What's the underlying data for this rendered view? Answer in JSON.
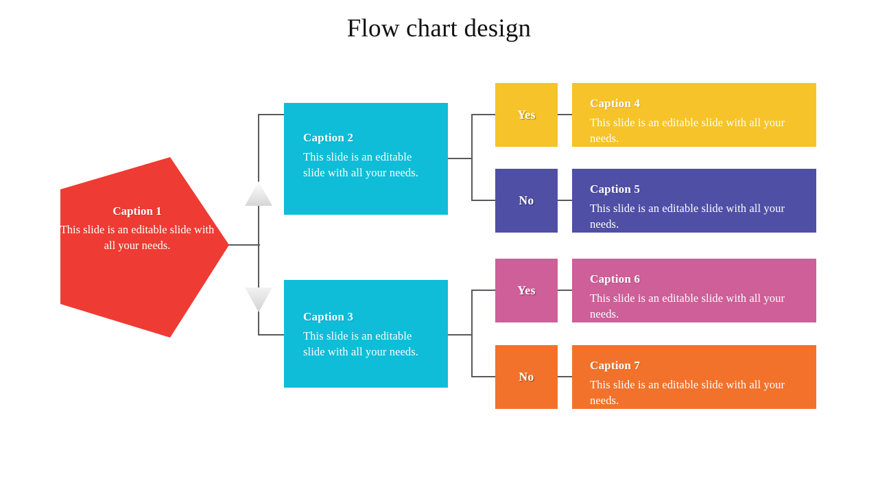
{
  "slide": {
    "title": "Flow chart design",
    "background": "#ffffff"
  },
  "colors": {
    "red": "#ee3b33",
    "cyan": "#0fbdd8",
    "yellow": "#f7c32a",
    "purple": "#4f4fa5",
    "pink": "#ce5f98",
    "orange": "#f2722b",
    "connector": "#595959",
    "triangle_top": "#ffffff",
    "triangle_bottom": "#d9d9d9",
    "text_light": "#ffffff",
    "title_text": "#121212"
  },
  "nodes": {
    "root": {
      "shape": "pentagon",
      "heading": "Caption 1",
      "body": "This slide is an editable slide with all your needs.",
      "color": "#ee3b33"
    },
    "branch_top": {
      "shape": "rectangle",
      "heading": "Caption 2",
      "body": "This slide is an editable slide with all your needs.",
      "color": "#0fbdd8"
    },
    "branch_bottom": {
      "shape": "rectangle",
      "heading": "Caption 3",
      "body": "This slide is an editable slide with all your needs.",
      "color": "#0fbdd8"
    }
  },
  "decisions": [
    {
      "label": "Yes",
      "color": "#f7c32a"
    },
    {
      "label": "No",
      "color": "#4f4fa5"
    },
    {
      "label": "Yes",
      "color": "#ce5f98"
    },
    {
      "label": "No",
      "color": "#f2722b"
    }
  ],
  "leaves": [
    {
      "heading": "Caption 4",
      "body": "This slide is an editable slide with all your needs.",
      "color": "#f7c32a"
    },
    {
      "heading": "Caption 5",
      "body": "This slide is an editable slide with all your needs.",
      "color": "#4f4fa5"
    },
    {
      "heading": "Caption 6",
      "body": "This slide is an editable slide with all your needs.",
      "color": "#ce5f98"
    },
    {
      "heading": "Caption 7",
      "body": "This slide is an editable slide with all your needs.",
      "color": "#f2722b"
    }
  ],
  "arrows": {
    "up_label": "up-arrow",
    "down_label": "down-arrow"
  },
  "chart_data": {
    "type": "diagram",
    "title": "Flow chart design",
    "structure": "decision-tree",
    "levels": 3,
    "edges": [
      {
        "from": "Caption 1",
        "to": "Caption 2",
        "marker": "up-arrow"
      },
      {
        "from": "Caption 1",
        "to": "Caption 3",
        "marker": "down-arrow"
      },
      {
        "from": "Caption 2",
        "to": "Yes",
        "label": "Yes"
      },
      {
        "from": "Caption 2",
        "to": "No",
        "label": "No"
      },
      {
        "from": "Yes",
        "to": "Caption 4"
      },
      {
        "from": "No",
        "to": "Caption 5"
      },
      {
        "from": "Caption 3",
        "to": "Yes",
        "label": "Yes"
      },
      {
        "from": "Caption 3",
        "to": "No",
        "label": "No"
      },
      {
        "from": "Yes",
        "to": "Caption 6"
      },
      {
        "from": "No",
        "to": "Caption 7"
      }
    ]
  }
}
